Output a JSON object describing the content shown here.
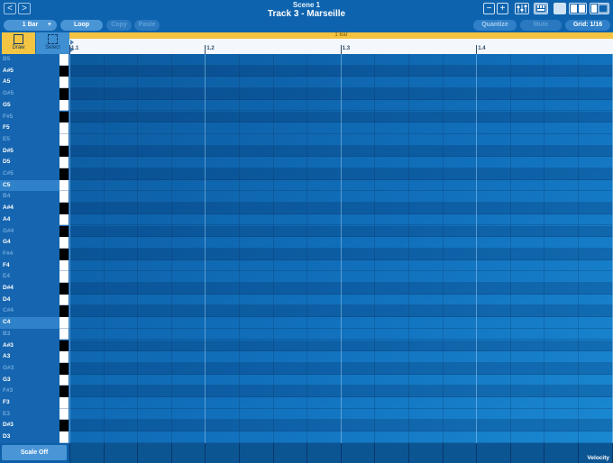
{
  "header": {
    "scene_title": "Scene 1",
    "track_title": "Track 3 - Marseille",
    "nav_back": "<",
    "nav_forward": ">"
  },
  "toolbar": {
    "length_label": "1 Bar",
    "add_label": "+",
    "loop_label": "Loop",
    "copy_label": "Copy",
    "paste_label": "Paste",
    "quantize_label": "Quantize",
    "mute_label": "Mute",
    "grid_label": "Grid: 1/16"
  },
  "tools": {
    "draw_label": "Draw",
    "select_label": "Select"
  },
  "ruler": {
    "loop_label": "1 Bar",
    "ticks": [
      "1.1",
      "1.2",
      "1.3",
      "1.4"
    ]
  },
  "keys": [
    {
      "label": "B5",
      "dim": true
    },
    {
      "label": "A#5",
      "dim": false
    },
    {
      "label": "A5",
      "dim": false
    },
    {
      "label": "G#5",
      "dim": true
    },
    {
      "label": "G5",
      "dim": false
    },
    {
      "label": "F#5",
      "dim": true
    },
    {
      "label": "F5",
      "dim": false
    },
    {
      "label": "E5",
      "dim": true
    },
    {
      "label": "D#5",
      "dim": false
    },
    {
      "label": "D5",
      "dim": false
    },
    {
      "label": "C#5",
      "dim": true
    },
    {
      "label": "C5",
      "dim": false
    },
    {
      "label": "B4",
      "dim": true
    },
    {
      "label": "A#4",
      "dim": false
    },
    {
      "label": "A4",
      "dim": false
    },
    {
      "label": "G#4",
      "dim": true
    },
    {
      "label": "G4",
      "dim": false
    },
    {
      "label": "F#4",
      "dim": true
    },
    {
      "label": "F4",
      "dim": false
    },
    {
      "label": "E4",
      "dim": true
    },
    {
      "label": "D#4",
      "dim": false
    },
    {
      "label": "D4",
      "dim": false
    },
    {
      "label": "C#4",
      "dim": true
    },
    {
      "label": "C4",
      "dim": false
    },
    {
      "label": "B3",
      "dim": true
    },
    {
      "label": "A#3",
      "dim": false
    },
    {
      "label": "A3",
      "dim": false
    },
    {
      "label": "G#3",
      "dim": true
    },
    {
      "label": "G3",
      "dim": false
    },
    {
      "label": "F#3",
      "dim": true
    },
    {
      "label": "F3",
      "dim": false
    },
    {
      "label": "E3",
      "dim": true
    },
    {
      "label": "D#3",
      "dim": false
    },
    {
      "label": "D3",
      "dim": false
    }
  ],
  "footer": {
    "scale_label": "Scale Off",
    "velocity_label": "Velocity"
  },
  "colors": {
    "accent": "#f4c542",
    "background": "#0d5fa8",
    "pill_active": "#4a95d6"
  },
  "icons": [
    "back-icon",
    "forward-icon",
    "zoom-out-icon",
    "zoom-in-icon",
    "mixer-icon",
    "keyboard-icon",
    "layout-icon",
    "draw-icon",
    "select-icon"
  ]
}
